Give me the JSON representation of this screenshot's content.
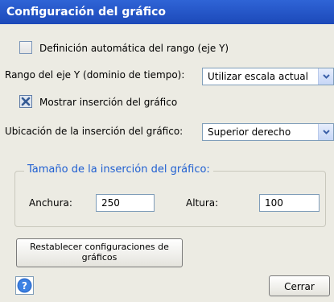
{
  "window": {
    "title": "Configuración del gráfico"
  },
  "auto_range": {
    "label": "Definición automática del rango (eje Y)",
    "checked": false
  },
  "y_range": {
    "label": "Rango del eje Y (dominio de tiempo):",
    "value": "Utilizar escala actual"
  },
  "show_insert": {
    "label": "Mostrar inserción del gráfico",
    "checked": true
  },
  "insert_location": {
    "label": "Ubicación de la inserción del gráfico:",
    "value": "Superior derecho"
  },
  "insert_size": {
    "group_title": "Tamaño de la inserción del gráfico:",
    "width_label": "Anchura:",
    "width_value": "250",
    "height_label": "Altura:",
    "height_value": "100"
  },
  "buttons": {
    "reset_line1": "Restablecer configuraciones de",
    "reset_line2": "gráficos",
    "close": "Cerrar"
  },
  "colors": {
    "title_bar": "#1c49b9",
    "group_title": "#1f5fd1",
    "dialog_bg": "#ecebe3"
  },
  "icons": {
    "help": "help-icon",
    "dropdown": "chevron-down-icon",
    "check": "check-icon"
  }
}
